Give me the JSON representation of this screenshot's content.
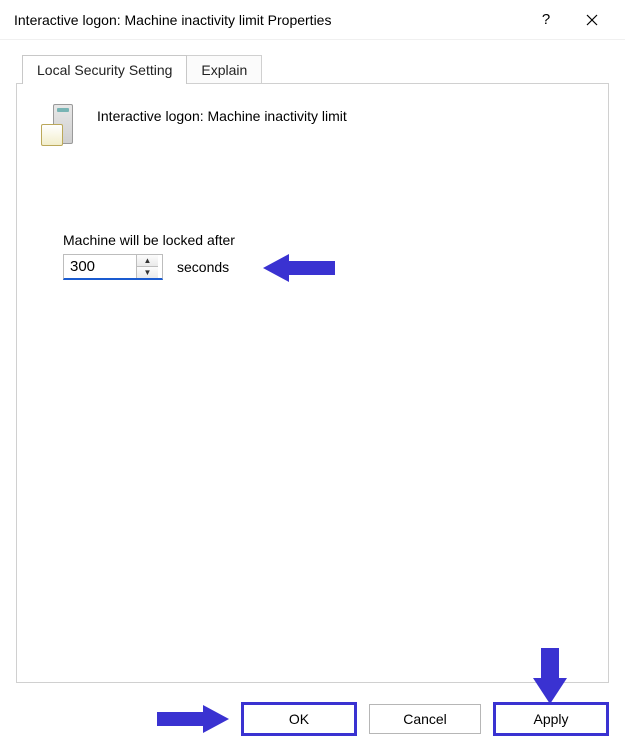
{
  "window": {
    "title": "Interactive logon: Machine inactivity limit Properties"
  },
  "tabs": {
    "setting": "Local Security Setting",
    "explain": "Explain"
  },
  "policy": {
    "title": "Interactive logon: Machine inactivity limit",
    "field_label": "Machine will be locked after",
    "value": "300",
    "unit": "seconds"
  },
  "buttons": {
    "ok": "OK",
    "cancel": "Cancel",
    "apply": "Apply"
  }
}
